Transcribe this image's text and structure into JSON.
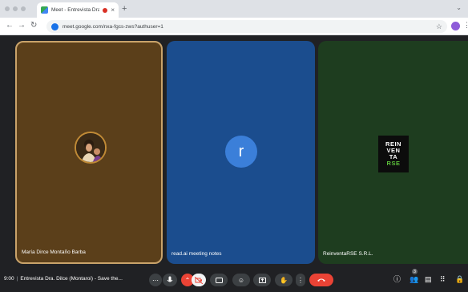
{
  "browser": {
    "tab_title": "Meet - Entrevista Dra. D",
    "url": "meet.google.com/nxa-fgcs-zws?authuser=1"
  },
  "icons": {
    "back": "back-arrow-icon",
    "forward": "forward-arrow-icon",
    "reload": "reload-icon",
    "bookmark": "star-icon"
  },
  "participants": [
    {
      "name": "María Dirce Montaño Barba",
      "avatar": "photo"
    },
    {
      "name": "read.ai meeting notes",
      "avatar_letter": "r"
    },
    {
      "name": "ReinventaRSE S.R.L.",
      "logo_lines": [
        "REIN",
        "VEN",
        "TA",
        "RSE"
      ]
    }
  ],
  "meeting": {
    "time": "9:00",
    "title": "Entrevista Dra. Dilce (Montaroi) - Save the...",
    "participant_count": "3"
  },
  "colors": {
    "tile1_bg": "#5b3f1a",
    "tile2_bg": "#1b4d8e",
    "tile3_bg": "#1e3d1f",
    "hangup": "#ea4335"
  }
}
